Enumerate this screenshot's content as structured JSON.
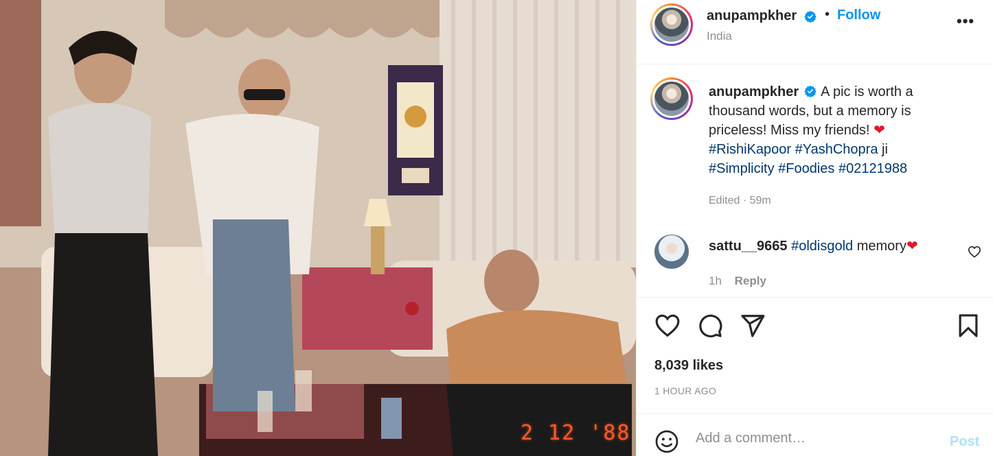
{
  "post": {
    "photo": {
      "alt": "Vintage photo",
      "datestamp": "2 12 '88"
    },
    "header": {
      "username": "anupampkher",
      "dot": "•",
      "follow_label": "Follow",
      "location": "India",
      "more_label": "•••"
    },
    "caption": {
      "username": "anupampkher",
      "text": "A pic is worth a thousand words, but a memory is priceless! Miss my friends!",
      "heart": "❤",
      "tags": [
        "#RishiKapoor",
        "#YashChopra",
        "#Simplicity",
        "#Foodies",
        "#02121988"
      ],
      "mid_word": "ji",
      "edited": "Edited · 59m"
    },
    "comment": {
      "username": "sattu__9665",
      "tag": "#oldisgold",
      "text": "memory",
      "heart": "❤",
      "time": "1h",
      "reply_label": "Reply"
    },
    "actions": {
      "icons": [
        "heart-outline-icon",
        "comment-icon",
        "share-icon",
        "bookmark-icon"
      ]
    },
    "likes": "8,039 likes",
    "time_ago": "1 HOUR AGO",
    "add_comment": {
      "placeholder": "Add a comment…",
      "post_label": "Post"
    },
    "colors": {
      "link": "#00376b",
      "follow": "#0095f6",
      "post_disabled": "#b2dffc",
      "muted": "#8e8e8e",
      "red": "#e0182d"
    }
  }
}
